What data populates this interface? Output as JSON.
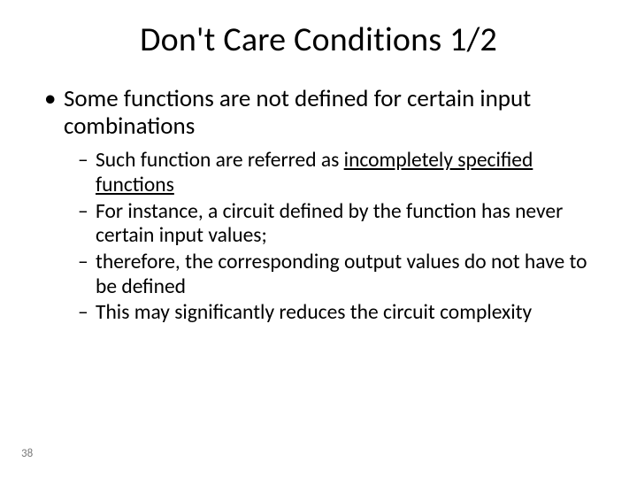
{
  "title": "Don't Care Conditions 1/2",
  "l1": "Some functions are not defined for certain input combinations",
  "sub": {
    "a_pre": "Such function are referred as ",
    "a_underlined": "incompletely specified functions",
    "b": "For instance, a circuit defined by the function has never certain input values;",
    "c": "therefore, the corresponding output values do not have to be defined",
    "d": "This may significantly reduces the circuit complexity"
  },
  "page": "38"
}
